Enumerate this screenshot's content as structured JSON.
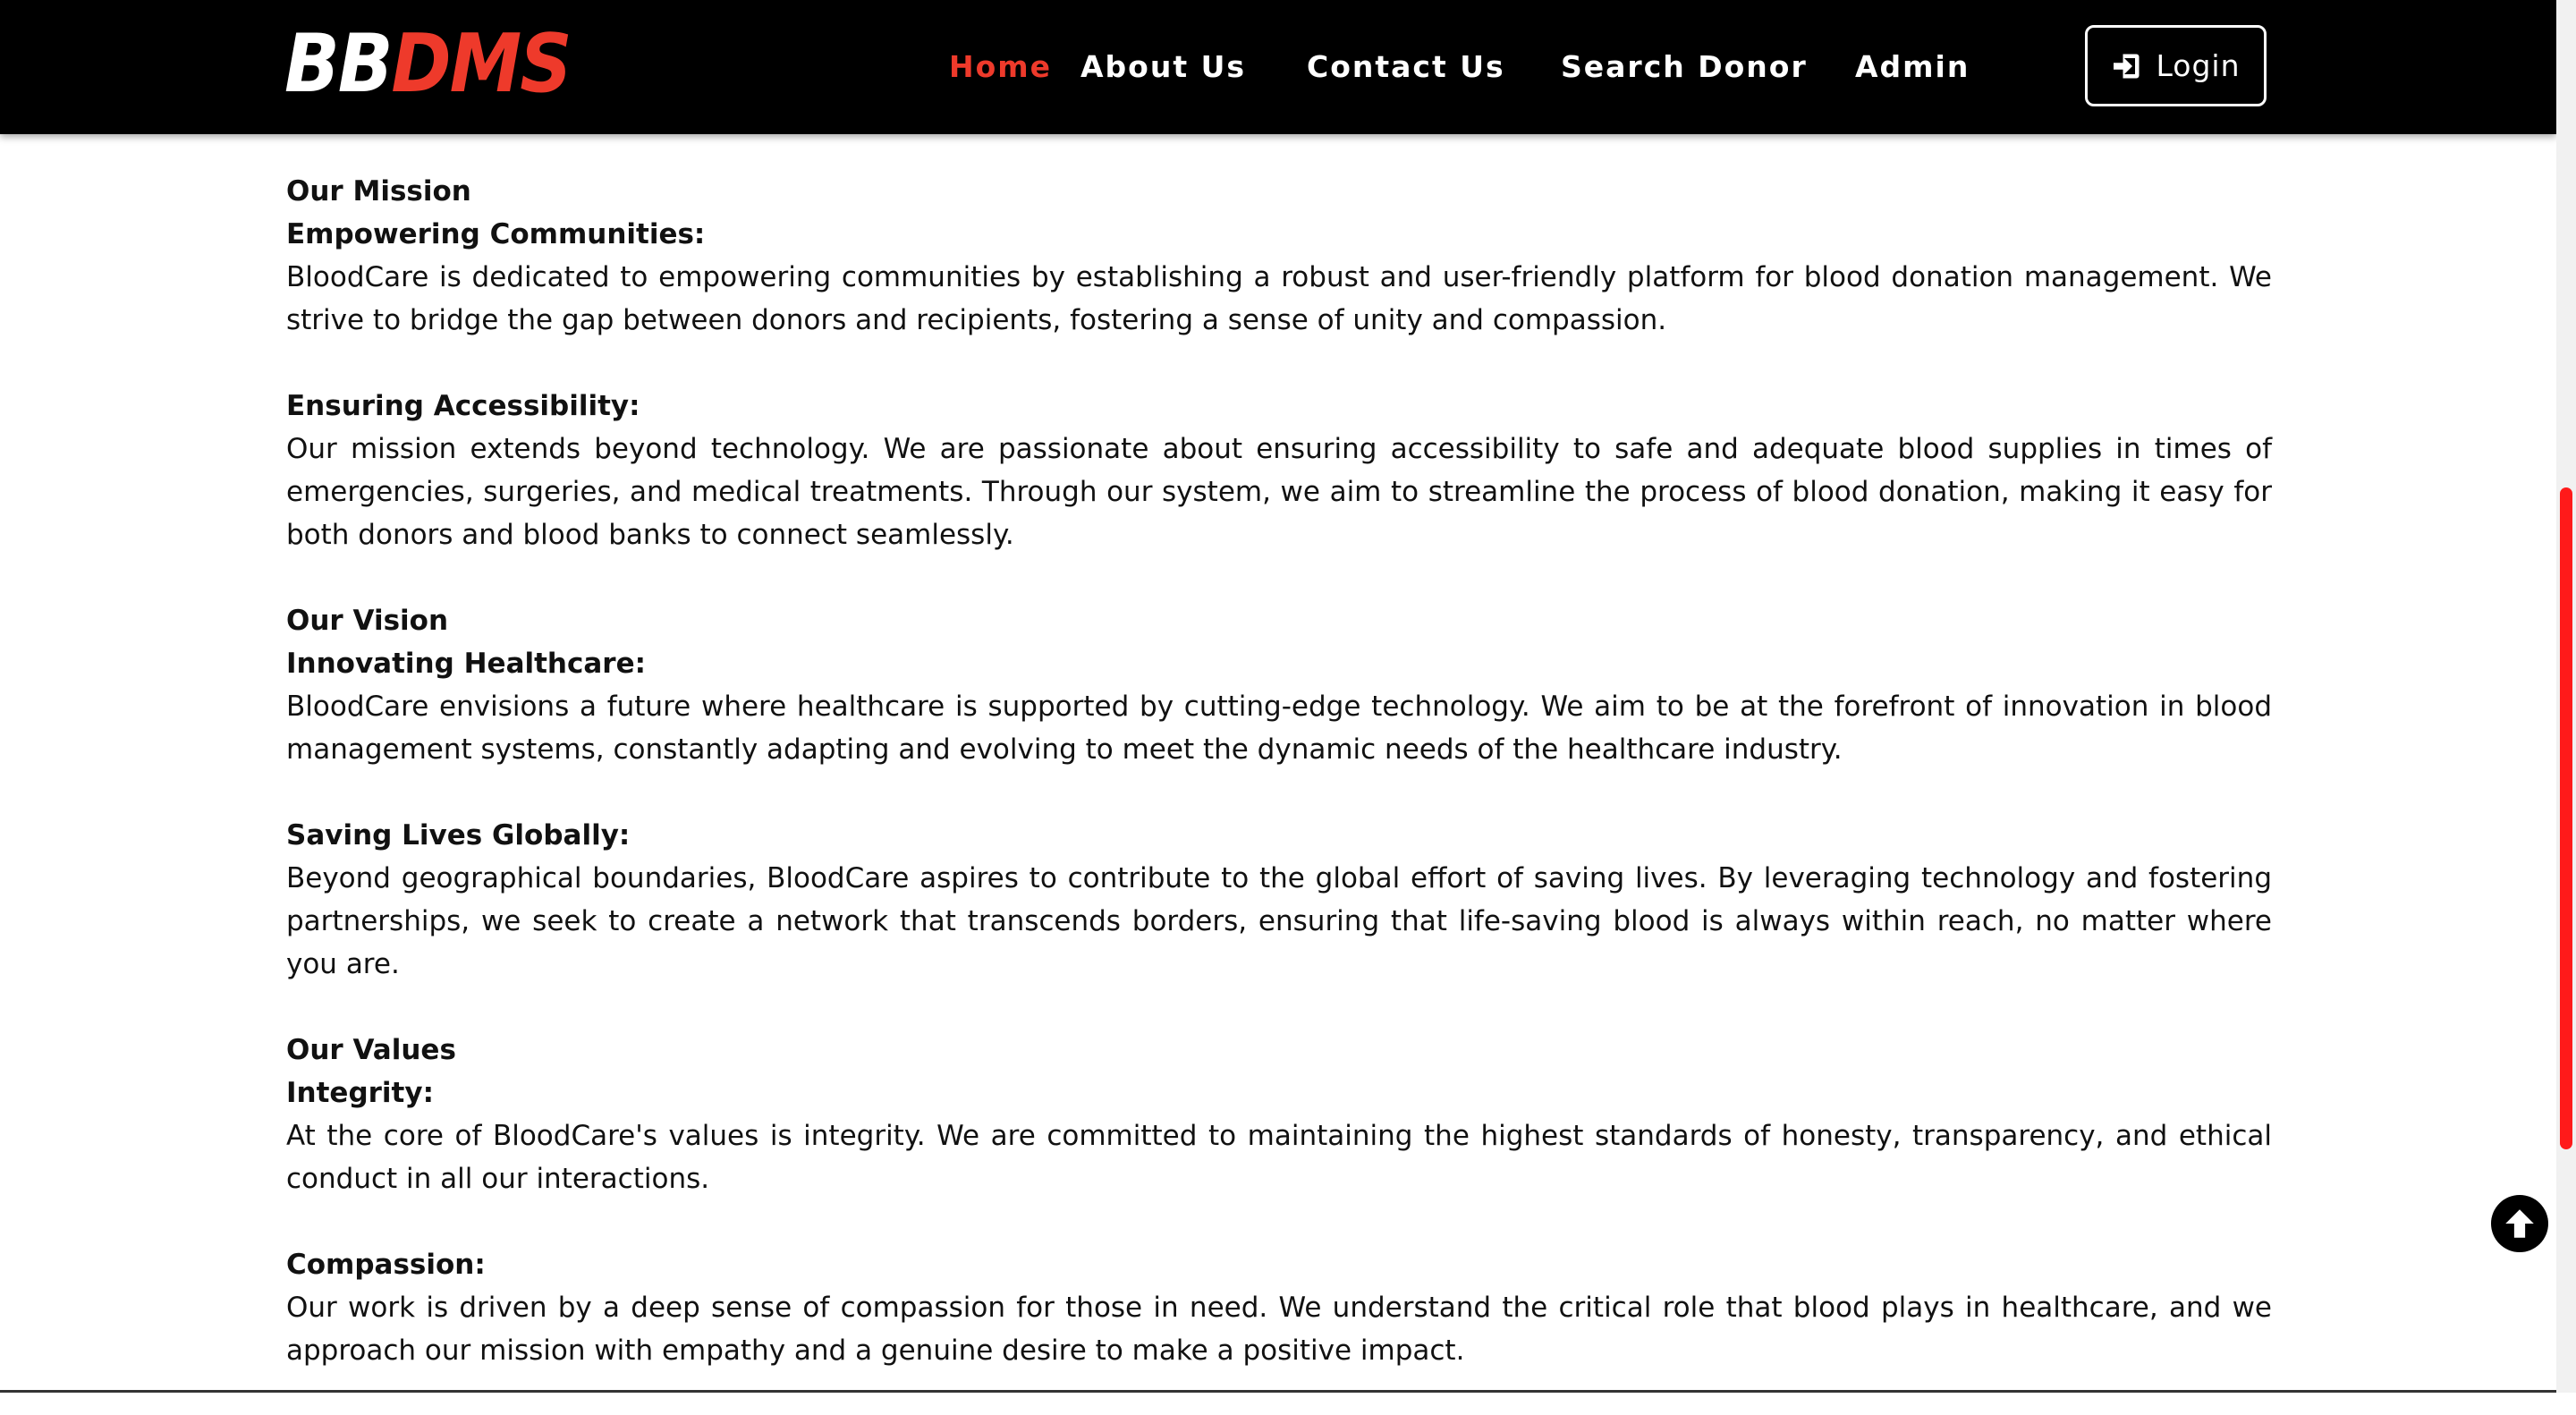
{
  "brand": {
    "part1": "BB",
    "part2": "DMS"
  },
  "nav": {
    "items": [
      {
        "label": "Home",
        "active": true
      },
      {
        "label": "About Us"
      },
      {
        "label": "Contact Us"
      },
      {
        "label": "Search Donor"
      },
      {
        "label": "Admin"
      }
    ],
    "login_label": "Login",
    "login_icon": "sign-in-icon"
  },
  "content": {
    "mission": {
      "title": "Our Mission",
      "blocks": [
        {
          "heading": "Empowering Communities:",
          "text": "BloodCare is dedicated to empowering communities by establishing a robust and user-friendly platform for blood donation management. We strive to bridge the gap between donors and recipients, fostering a sense of unity and compassion."
        },
        {
          "heading": "Ensuring Accessibility:",
          "text": "Our mission extends beyond technology. We are passionate about ensuring accessibility to safe and adequate blood supplies in times of emergencies, surgeries, and medical treatments. Through our system, we aim to streamline the process of blood donation, making it easy for both donors and blood banks to connect seamlessly."
        }
      ]
    },
    "vision": {
      "title": "Our Vision",
      "blocks": [
        {
          "heading": "Innovating Healthcare:",
          "text": "BloodCare envisions a future where healthcare is supported by cutting-edge technology. We aim to be at the forefront of innovation in blood management systems, constantly adapting and evolving to meet the dynamic needs of the healthcare industry."
        },
        {
          "heading": "Saving Lives Globally:",
          "text": "Beyond geographical boundaries, BloodCare aspires to contribute to the global effort of saving lives. By leveraging technology and fostering partnerships, we seek to create a network that transcends borders, ensuring that life-saving blood is always within reach, no matter where you are."
        }
      ]
    },
    "values": {
      "title": "Our Values",
      "blocks": [
        {
          "heading": "Integrity:",
          "text": "At the core of BloodCare's values is integrity. We are committed to maintaining the highest standards of honesty, transparency, and ethical conduct in all our interactions."
        },
        {
          "heading": "Compassion:",
          "text": "Our work is driven by a deep sense of compassion for those in need. We understand the critical role that blood plays in healthcare, and we approach our mission with empathy and a genuine desire to make a positive impact."
        }
      ]
    }
  },
  "scroll_top_icon": "arrow-up-circle-icon",
  "colors": {
    "accent": "#ee3a2b",
    "navbar_bg": "#000000",
    "scrollbar_thumb": "#ff1a1a"
  }
}
